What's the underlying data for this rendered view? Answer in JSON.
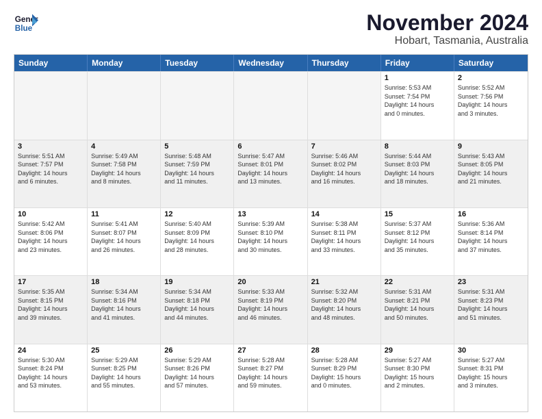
{
  "logo": {
    "line1": "General",
    "line2": "Blue"
  },
  "title": "November 2024",
  "subtitle": "Hobart, Tasmania, Australia",
  "header": {
    "days": [
      "Sunday",
      "Monday",
      "Tuesday",
      "Wednesday",
      "Thursday",
      "Friday",
      "Saturday"
    ]
  },
  "rows": [
    [
      {
        "day": "",
        "info": ""
      },
      {
        "day": "",
        "info": ""
      },
      {
        "day": "",
        "info": ""
      },
      {
        "day": "",
        "info": ""
      },
      {
        "day": "",
        "info": ""
      },
      {
        "day": "1",
        "info": "Sunrise: 5:53 AM\nSunset: 7:54 PM\nDaylight: 14 hours\nand 0 minutes."
      },
      {
        "day": "2",
        "info": "Sunrise: 5:52 AM\nSunset: 7:56 PM\nDaylight: 14 hours\nand 3 minutes."
      }
    ],
    [
      {
        "day": "3",
        "info": "Sunrise: 5:51 AM\nSunset: 7:57 PM\nDaylight: 14 hours\nand 6 minutes."
      },
      {
        "day": "4",
        "info": "Sunrise: 5:49 AM\nSunset: 7:58 PM\nDaylight: 14 hours\nand 8 minutes."
      },
      {
        "day": "5",
        "info": "Sunrise: 5:48 AM\nSunset: 7:59 PM\nDaylight: 14 hours\nand 11 minutes."
      },
      {
        "day": "6",
        "info": "Sunrise: 5:47 AM\nSunset: 8:01 PM\nDaylight: 14 hours\nand 13 minutes."
      },
      {
        "day": "7",
        "info": "Sunrise: 5:46 AM\nSunset: 8:02 PM\nDaylight: 14 hours\nand 16 minutes."
      },
      {
        "day": "8",
        "info": "Sunrise: 5:44 AM\nSunset: 8:03 PM\nDaylight: 14 hours\nand 18 minutes."
      },
      {
        "day": "9",
        "info": "Sunrise: 5:43 AM\nSunset: 8:05 PM\nDaylight: 14 hours\nand 21 minutes."
      }
    ],
    [
      {
        "day": "10",
        "info": "Sunrise: 5:42 AM\nSunset: 8:06 PM\nDaylight: 14 hours\nand 23 minutes."
      },
      {
        "day": "11",
        "info": "Sunrise: 5:41 AM\nSunset: 8:07 PM\nDaylight: 14 hours\nand 26 minutes."
      },
      {
        "day": "12",
        "info": "Sunrise: 5:40 AM\nSunset: 8:09 PM\nDaylight: 14 hours\nand 28 minutes."
      },
      {
        "day": "13",
        "info": "Sunrise: 5:39 AM\nSunset: 8:10 PM\nDaylight: 14 hours\nand 30 minutes."
      },
      {
        "day": "14",
        "info": "Sunrise: 5:38 AM\nSunset: 8:11 PM\nDaylight: 14 hours\nand 33 minutes."
      },
      {
        "day": "15",
        "info": "Sunrise: 5:37 AM\nSunset: 8:12 PM\nDaylight: 14 hours\nand 35 minutes."
      },
      {
        "day": "16",
        "info": "Sunrise: 5:36 AM\nSunset: 8:14 PM\nDaylight: 14 hours\nand 37 minutes."
      }
    ],
    [
      {
        "day": "17",
        "info": "Sunrise: 5:35 AM\nSunset: 8:15 PM\nDaylight: 14 hours\nand 39 minutes."
      },
      {
        "day": "18",
        "info": "Sunrise: 5:34 AM\nSunset: 8:16 PM\nDaylight: 14 hours\nand 41 minutes."
      },
      {
        "day": "19",
        "info": "Sunrise: 5:34 AM\nSunset: 8:18 PM\nDaylight: 14 hours\nand 44 minutes."
      },
      {
        "day": "20",
        "info": "Sunrise: 5:33 AM\nSunset: 8:19 PM\nDaylight: 14 hours\nand 46 minutes."
      },
      {
        "day": "21",
        "info": "Sunrise: 5:32 AM\nSunset: 8:20 PM\nDaylight: 14 hours\nand 48 minutes."
      },
      {
        "day": "22",
        "info": "Sunrise: 5:31 AM\nSunset: 8:21 PM\nDaylight: 14 hours\nand 50 minutes."
      },
      {
        "day": "23",
        "info": "Sunrise: 5:31 AM\nSunset: 8:23 PM\nDaylight: 14 hours\nand 51 minutes."
      }
    ],
    [
      {
        "day": "24",
        "info": "Sunrise: 5:30 AM\nSunset: 8:24 PM\nDaylight: 14 hours\nand 53 minutes."
      },
      {
        "day": "25",
        "info": "Sunrise: 5:29 AM\nSunset: 8:25 PM\nDaylight: 14 hours\nand 55 minutes."
      },
      {
        "day": "26",
        "info": "Sunrise: 5:29 AM\nSunset: 8:26 PM\nDaylight: 14 hours\nand 57 minutes."
      },
      {
        "day": "27",
        "info": "Sunrise: 5:28 AM\nSunset: 8:27 PM\nDaylight: 14 hours\nand 59 minutes."
      },
      {
        "day": "28",
        "info": "Sunrise: 5:28 AM\nSunset: 8:29 PM\nDaylight: 15 hours\nand 0 minutes."
      },
      {
        "day": "29",
        "info": "Sunrise: 5:27 AM\nSunset: 8:30 PM\nDaylight: 15 hours\nand 2 minutes."
      },
      {
        "day": "30",
        "info": "Sunrise: 5:27 AM\nSunset: 8:31 PM\nDaylight: 15 hours\nand 3 minutes."
      }
    ]
  ]
}
